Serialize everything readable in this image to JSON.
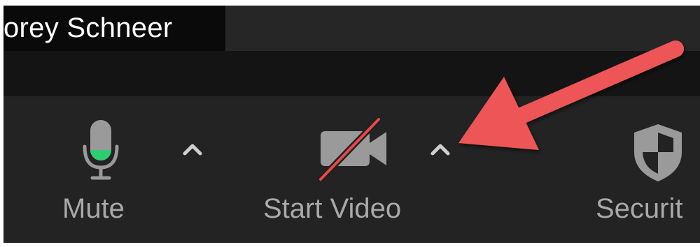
{
  "participant": {
    "name": "orey Schneer"
  },
  "toolbar": {
    "mute_label": "Mute",
    "start_video_label": "Start Video",
    "security_label": "Securit"
  },
  "icons": {
    "microphone": "microphone-icon",
    "video_off": "video-off-icon",
    "shield": "shield-icon",
    "caret": "chevron-up-icon",
    "annotation_arrow": "arrow-annotation"
  },
  "colors": {
    "mic_level": "#2ecc71",
    "video_slash": "#e8474b",
    "annotation_arrow": "#ee5556",
    "label_text": "#a9a9a9"
  }
}
